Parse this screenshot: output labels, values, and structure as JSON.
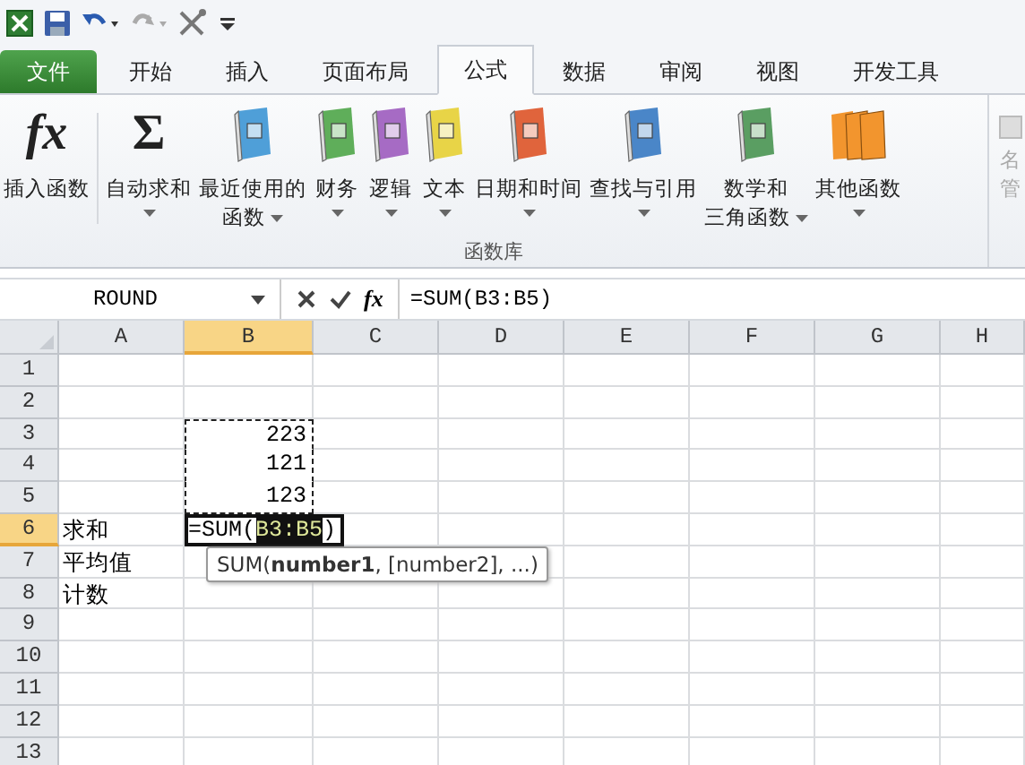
{
  "tabs": [
    {
      "label": "文件",
      "kind": "file",
      "selected": false
    },
    {
      "label": "开始",
      "kind": "tab",
      "selected": false
    },
    {
      "label": "插入",
      "kind": "tab",
      "selected": false
    },
    {
      "label": "页面布局",
      "kind": "tab",
      "selected": false
    },
    {
      "label": "公式",
      "kind": "tab",
      "selected": true
    },
    {
      "label": "数据",
      "kind": "tab",
      "selected": false
    },
    {
      "label": "审阅",
      "kind": "tab",
      "selected": false
    },
    {
      "label": "视图",
      "kind": "tab",
      "selected": false
    },
    {
      "label": "开发工具",
      "kind": "tab",
      "selected": false
    }
  ],
  "ribbon": {
    "group_label": "函数库",
    "buttons": [
      {
        "kind": "glyph",
        "glyph": "fx",
        "lines": [
          "插入函数"
        ],
        "dropdown": false
      },
      {
        "kind": "glyph",
        "glyph": "Σ",
        "lines": [
          "自动求和"
        ],
        "dropdown": true
      },
      {
        "kind": "book",
        "color": "#4f9fd8",
        "lines": [
          "最近使用的",
          "函数"
        ],
        "dropdown": true
      },
      {
        "kind": "book",
        "color": "#5fae5a",
        "lines": [
          "财务"
        ],
        "dropdown": true
      },
      {
        "kind": "book",
        "color": "#a66bc4",
        "lines": [
          "逻辑"
        ],
        "dropdown": true
      },
      {
        "kind": "book",
        "color": "#e8d447",
        "lines": [
          "文本"
        ],
        "dropdown": true
      },
      {
        "kind": "book",
        "color": "#e0643c",
        "lines": [
          "日期和时间"
        ],
        "dropdown": true
      },
      {
        "kind": "book",
        "color": "#4a86c8",
        "lines": [
          "查找与引用"
        ],
        "dropdown": true
      },
      {
        "kind": "book",
        "color": "#5a9e62",
        "lines": [
          "数学和",
          "三角函数"
        ],
        "dropdown": true
      },
      {
        "kind": "books",
        "color": "#f2952e",
        "lines": [
          "其他函数"
        ],
        "dropdown": true
      }
    ],
    "cut_button": {
      "lines": [
        "名",
        "管"
      ]
    }
  },
  "formula_bar": {
    "name_box": "ROUND",
    "fx": "fx",
    "formula": "=SUM(B3:B5)"
  },
  "sheet": {
    "columns": [
      {
        "label": "A",
        "selected": false
      },
      {
        "label": "B",
        "selected": true
      },
      {
        "label": "C",
        "selected": false
      },
      {
        "label": "D",
        "selected": false
      },
      {
        "label": "E",
        "selected": false
      },
      {
        "label": "F",
        "selected": false
      },
      {
        "label": "G",
        "selected": false
      },
      {
        "label": "H",
        "selected": false
      }
    ],
    "rows": [
      {
        "label": "1",
        "selected": false
      },
      {
        "label": "2",
        "selected": false
      },
      {
        "label": "3",
        "selected": false,
        "b": {
          "value": "223",
          "referenced": true
        }
      },
      {
        "label": "4",
        "selected": false,
        "b": {
          "value": "121",
          "referenced": true
        }
      },
      {
        "label": "5",
        "selected": false,
        "b": {
          "value": "123",
          "referenced": true
        }
      },
      {
        "label": "6",
        "selected": true,
        "a": {
          "value": "求和"
        },
        "b": {
          "kind": "editing",
          "before": "=SUM(",
          "ref": "B3:B5",
          "after": ")",
          "tooltip": "SUM(**number1**, [number2], ...)"
        }
      },
      {
        "label": "7",
        "selected": false,
        "a": {
          "value": "平均值"
        }
      },
      {
        "label": "8",
        "selected": false,
        "a": {
          "value": "计数"
        }
      },
      {
        "label": "9",
        "selected": false
      },
      {
        "label": "10",
        "selected": false
      },
      {
        "label": "11",
        "selected": false
      },
      {
        "label": "12",
        "selected": false
      },
      {
        "label": "13",
        "selected": false
      }
    ]
  }
}
